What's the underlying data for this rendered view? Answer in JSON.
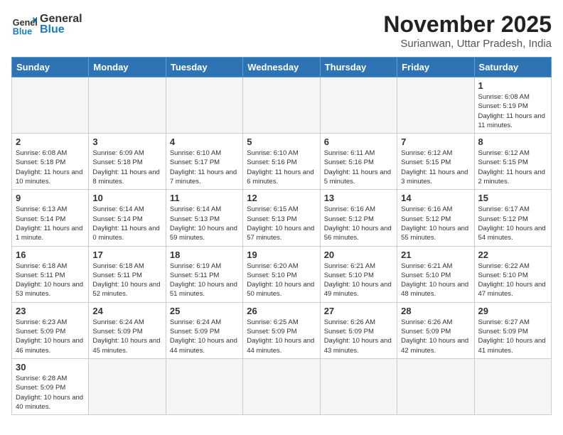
{
  "header": {
    "logo_general": "General",
    "logo_blue": "Blue",
    "month_title": "November 2025",
    "subtitle": "Surianwan, Uttar Pradesh, India"
  },
  "weekdays": [
    "Sunday",
    "Monday",
    "Tuesday",
    "Wednesday",
    "Thursday",
    "Friday",
    "Saturday"
  ],
  "weeks": [
    [
      {
        "day": "",
        "info": ""
      },
      {
        "day": "",
        "info": ""
      },
      {
        "day": "",
        "info": ""
      },
      {
        "day": "",
        "info": ""
      },
      {
        "day": "",
        "info": ""
      },
      {
        "day": "",
        "info": ""
      },
      {
        "day": "1",
        "info": "Sunrise: 6:08 AM\nSunset: 5:19 PM\nDaylight: 11 hours and 11 minutes."
      }
    ],
    [
      {
        "day": "2",
        "info": "Sunrise: 6:08 AM\nSunset: 5:18 PM\nDaylight: 11 hours and 10 minutes."
      },
      {
        "day": "3",
        "info": "Sunrise: 6:09 AM\nSunset: 5:18 PM\nDaylight: 11 hours and 8 minutes."
      },
      {
        "day": "4",
        "info": "Sunrise: 6:10 AM\nSunset: 5:17 PM\nDaylight: 11 hours and 7 minutes."
      },
      {
        "day": "5",
        "info": "Sunrise: 6:10 AM\nSunset: 5:16 PM\nDaylight: 11 hours and 6 minutes."
      },
      {
        "day": "6",
        "info": "Sunrise: 6:11 AM\nSunset: 5:16 PM\nDaylight: 11 hours and 5 minutes."
      },
      {
        "day": "7",
        "info": "Sunrise: 6:12 AM\nSunset: 5:15 PM\nDaylight: 11 hours and 3 minutes."
      },
      {
        "day": "8",
        "info": "Sunrise: 6:12 AM\nSunset: 5:15 PM\nDaylight: 11 hours and 2 minutes."
      }
    ],
    [
      {
        "day": "9",
        "info": "Sunrise: 6:13 AM\nSunset: 5:14 PM\nDaylight: 11 hours and 1 minute."
      },
      {
        "day": "10",
        "info": "Sunrise: 6:14 AM\nSunset: 5:14 PM\nDaylight: 11 hours and 0 minutes."
      },
      {
        "day": "11",
        "info": "Sunrise: 6:14 AM\nSunset: 5:13 PM\nDaylight: 10 hours and 59 minutes."
      },
      {
        "day": "12",
        "info": "Sunrise: 6:15 AM\nSunset: 5:13 PM\nDaylight: 10 hours and 57 minutes."
      },
      {
        "day": "13",
        "info": "Sunrise: 6:16 AM\nSunset: 5:12 PM\nDaylight: 10 hours and 56 minutes."
      },
      {
        "day": "14",
        "info": "Sunrise: 6:16 AM\nSunset: 5:12 PM\nDaylight: 10 hours and 55 minutes."
      },
      {
        "day": "15",
        "info": "Sunrise: 6:17 AM\nSunset: 5:12 PM\nDaylight: 10 hours and 54 minutes."
      }
    ],
    [
      {
        "day": "16",
        "info": "Sunrise: 6:18 AM\nSunset: 5:11 PM\nDaylight: 10 hours and 53 minutes."
      },
      {
        "day": "17",
        "info": "Sunrise: 6:18 AM\nSunset: 5:11 PM\nDaylight: 10 hours and 52 minutes."
      },
      {
        "day": "18",
        "info": "Sunrise: 6:19 AM\nSunset: 5:11 PM\nDaylight: 10 hours and 51 minutes."
      },
      {
        "day": "19",
        "info": "Sunrise: 6:20 AM\nSunset: 5:10 PM\nDaylight: 10 hours and 50 minutes."
      },
      {
        "day": "20",
        "info": "Sunrise: 6:21 AM\nSunset: 5:10 PM\nDaylight: 10 hours and 49 minutes."
      },
      {
        "day": "21",
        "info": "Sunrise: 6:21 AM\nSunset: 5:10 PM\nDaylight: 10 hours and 48 minutes."
      },
      {
        "day": "22",
        "info": "Sunrise: 6:22 AM\nSunset: 5:10 PM\nDaylight: 10 hours and 47 minutes."
      }
    ],
    [
      {
        "day": "23",
        "info": "Sunrise: 6:23 AM\nSunset: 5:09 PM\nDaylight: 10 hours and 46 minutes."
      },
      {
        "day": "24",
        "info": "Sunrise: 6:24 AM\nSunset: 5:09 PM\nDaylight: 10 hours and 45 minutes."
      },
      {
        "day": "25",
        "info": "Sunrise: 6:24 AM\nSunset: 5:09 PM\nDaylight: 10 hours and 44 minutes."
      },
      {
        "day": "26",
        "info": "Sunrise: 6:25 AM\nSunset: 5:09 PM\nDaylight: 10 hours and 44 minutes."
      },
      {
        "day": "27",
        "info": "Sunrise: 6:26 AM\nSunset: 5:09 PM\nDaylight: 10 hours and 43 minutes."
      },
      {
        "day": "28",
        "info": "Sunrise: 6:26 AM\nSunset: 5:09 PM\nDaylight: 10 hours and 42 minutes."
      },
      {
        "day": "29",
        "info": "Sunrise: 6:27 AM\nSunset: 5:09 PM\nDaylight: 10 hours and 41 minutes."
      }
    ],
    [
      {
        "day": "30",
        "info": "Sunrise: 6:28 AM\nSunset: 5:09 PM\nDaylight: 10 hours and 40 minutes."
      },
      {
        "day": "",
        "info": ""
      },
      {
        "day": "",
        "info": ""
      },
      {
        "day": "",
        "info": ""
      },
      {
        "day": "",
        "info": ""
      },
      {
        "day": "",
        "info": ""
      },
      {
        "day": "",
        "info": ""
      }
    ]
  ]
}
